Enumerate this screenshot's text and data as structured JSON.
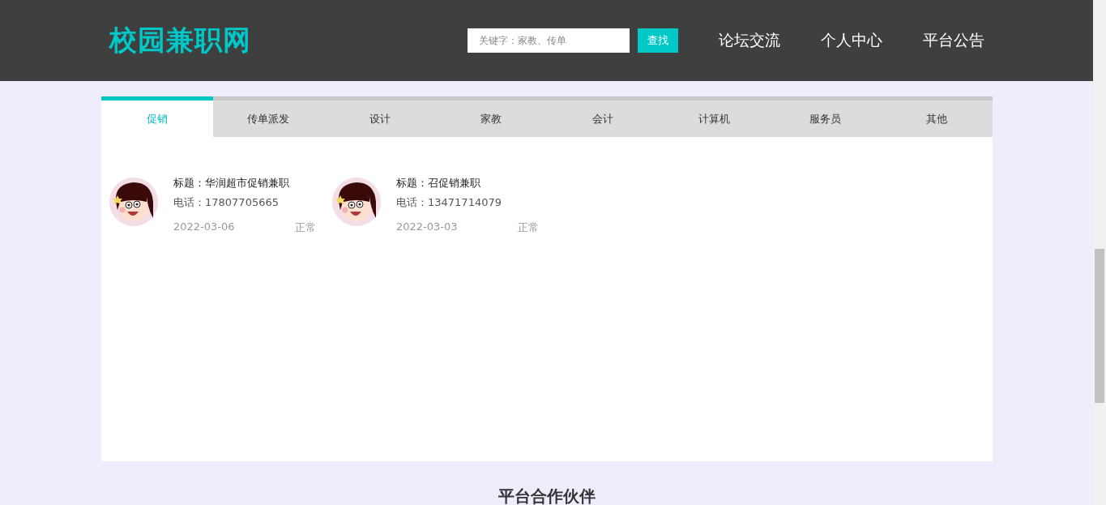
{
  "header": {
    "logo": "校园兼职网",
    "search": {
      "placeholder": "关键字：家教、传单",
      "button": "查找"
    },
    "nav": [
      "论坛交流",
      "个人中心",
      "平台公告"
    ]
  },
  "tabs": [
    {
      "label": "促销",
      "selected": true
    },
    {
      "label": "传单派发",
      "selected": false
    },
    {
      "label": "设计",
      "selected": false
    },
    {
      "label": "家教",
      "selected": false
    },
    {
      "label": "会计",
      "selected": false
    },
    {
      "label": "计算机",
      "selected": false
    },
    {
      "label": "服务员",
      "selected": false
    },
    {
      "label": "其他",
      "selected": false
    }
  ],
  "jobs": [
    {
      "title": "标题：华润超市促销兼职",
      "phone": "电话：17807705665",
      "date": "2022-03-06",
      "status": "正常"
    },
    {
      "title": "标题：召促销兼职",
      "phone": "电话：13471714079",
      "date": "2022-03-03",
      "status": "正常"
    }
  ],
  "partners": {
    "heading": "平台合作伙伴"
  }
}
